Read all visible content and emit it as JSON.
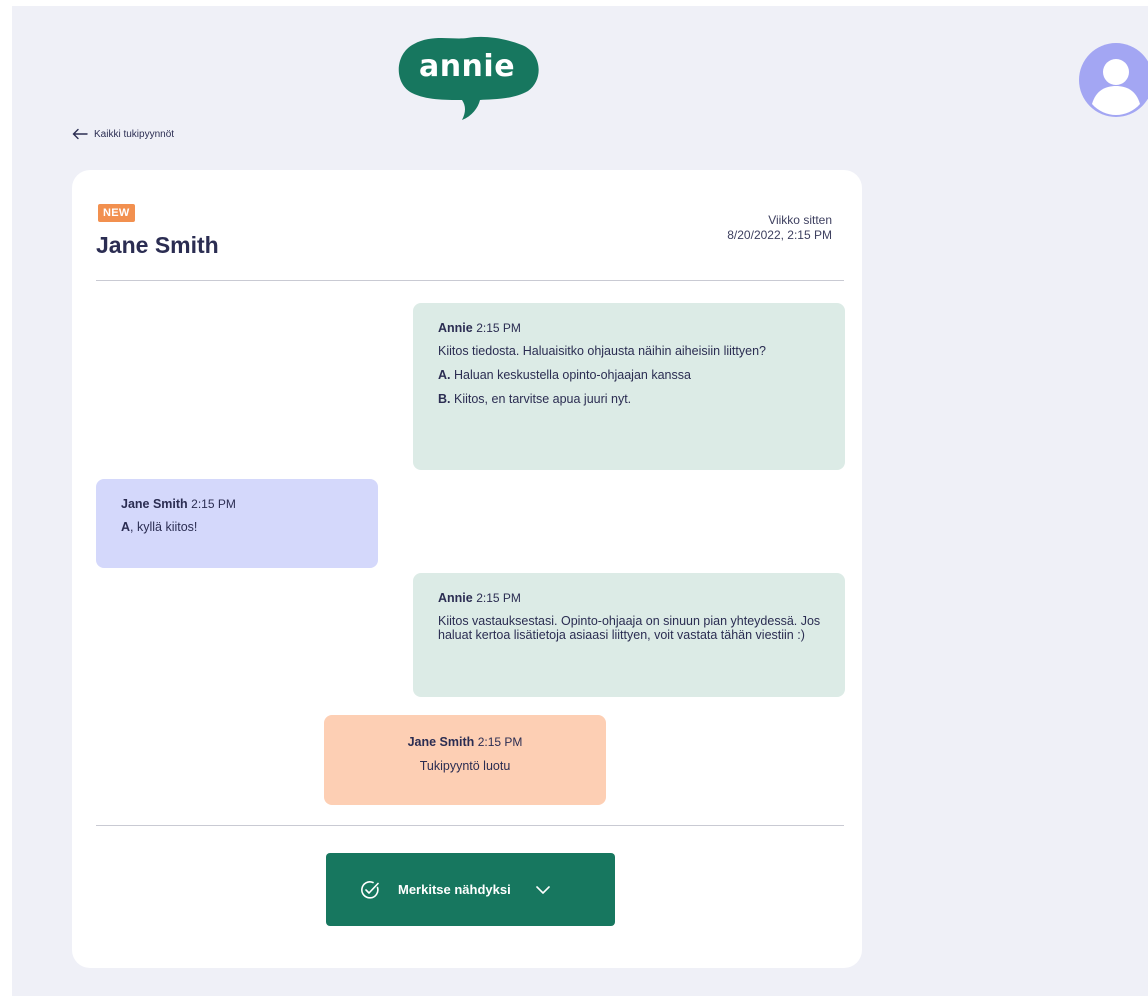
{
  "brand": {
    "logo_text": "annie",
    "color": "#17775f"
  },
  "nav": {
    "back_label": "Kaikki tukipyynnöt"
  },
  "ticket": {
    "badge": "NEW",
    "requester_name": "Jane Smith",
    "relative_time": "Viikko sitten",
    "timestamp": "8/20/2022, 2:15 PM"
  },
  "messages": [
    {
      "sender": "Annie",
      "time": "2:15 PM",
      "text": "Kiitos tiedosta. Haluaisitko ohjausta näihin aiheisiin liittyen?",
      "options": [
        {
          "key": "A.",
          "text": "Haluan keskustella opinto-ohjaajan kanssa"
        },
        {
          "key": "B.",
          "text": "Kiitos, en tarvitse apua juuri nyt."
        }
      ],
      "color": "#dcebe6"
    },
    {
      "sender": "Jane Smith",
      "time": "2:15 PM",
      "answer_key": "A",
      "answer_text": ", kyllä kiitos!",
      "color": "#d4d8fb"
    },
    {
      "sender": "Annie",
      "time": "2:15 PM",
      "text": "Kiitos vastauksestasi. Opinto-ohjaaja on sinuun pian yhteydessä. Jos haluat kertoa lisätietoja asiaasi liittyen, voit vastata tähän viestiin :)",
      "color": "#dcebe6"
    },
    {
      "sender": "Jane Smith",
      "time": "2:15 PM",
      "text": "Tukipyyntö luotu",
      "color": "#fdcfb4"
    }
  ],
  "actions": {
    "mark_seen_label": "Merkitse nähdyksi"
  },
  "icons": {
    "back": "arrow-left-icon",
    "avatar": "user-avatar-icon",
    "check": "check-circle-icon",
    "dropdown": "chevron-down-icon"
  },
  "colors": {
    "badge": "#f2904f",
    "bot_bubble": "#dcebe6",
    "user_bubble": "#d4d8fb",
    "system_bubble": "#fdcfb4",
    "avatar": "#a3a6f3",
    "text": "#2b2d52"
  }
}
